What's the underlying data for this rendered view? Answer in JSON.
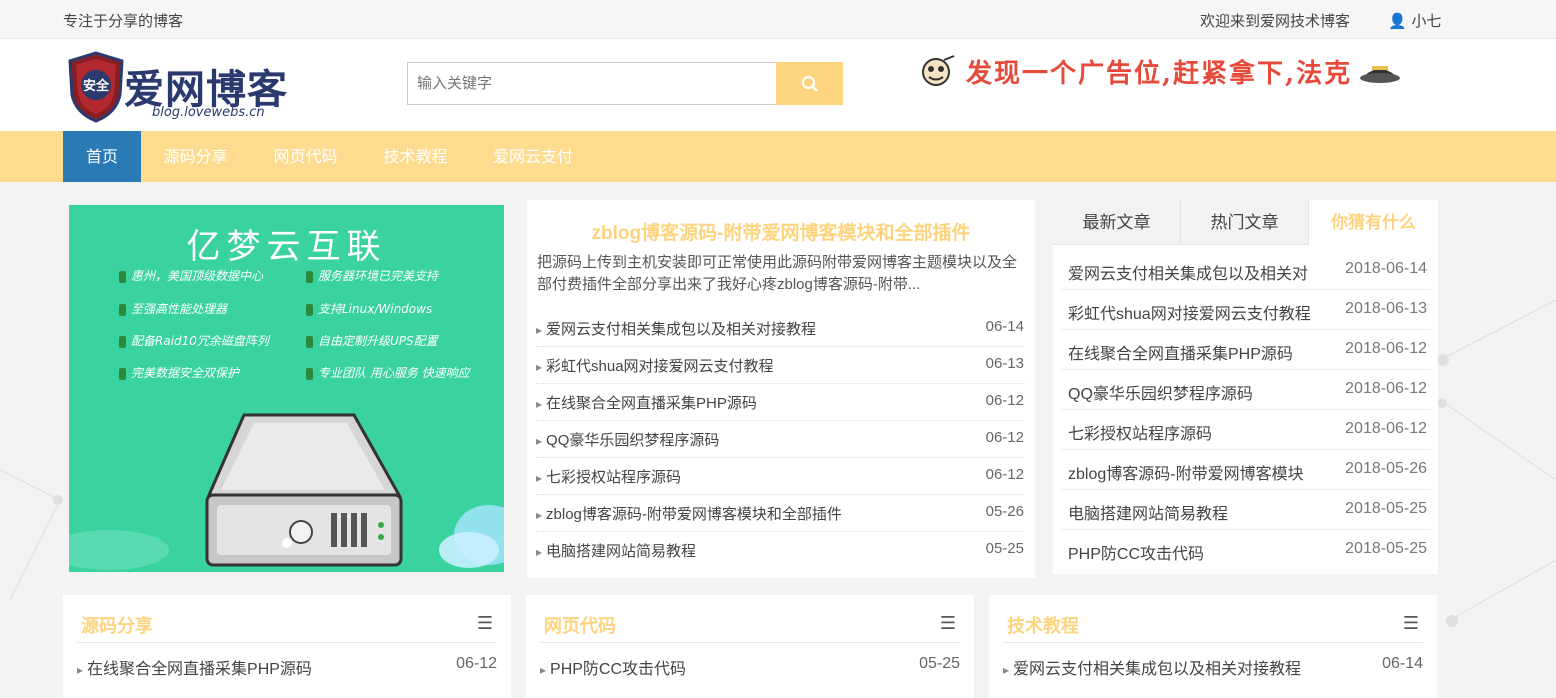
{
  "topbar": {
    "tagline": "专注于分享的博客",
    "welcome": "欢迎来到爱网技术博客",
    "user": "小七"
  },
  "logo": {
    "badge": "安全",
    "name": "爱网博客",
    "domain": "blog.lovewebs.cn"
  },
  "search": {
    "placeholder": "输入关键字"
  },
  "ad": {
    "text": "发现一个广告位,赶紧拿下,法克"
  },
  "nav": [
    "首页",
    "源码分享",
    "网页代码",
    "技术教程",
    "爱网云支付"
  ],
  "slide": {
    "title": "亿梦云互联",
    "features": [
      "惠州，美国顶级数据中心",
      "服务器环境已完美支持",
      "至强高性能处理器",
      "支持Linux/Windows",
      "配备Raid10冗余磁盘阵列",
      "自由定制升级UPS配置",
      "完美数据安全双保护",
      "专业团队 用心服务 快速响应"
    ]
  },
  "headline": {
    "title": "zblog博客源码-附带爱网博客模块和全部插件",
    "desc": "把源码上传到主机安装即可正常使用此源码附带爱网博客主题模块以及全部付费插件全部分享出来了我好心疼zblog博客源码-附带..."
  },
  "latest": [
    {
      "title": "爱网云支付相关集成包以及相关对接教程",
      "date": "06-14"
    },
    {
      "title": "彩虹代shua网对接爱网云支付教程",
      "date": "06-13"
    },
    {
      "title": "在线聚合全网直播采集PHP源码",
      "date": "06-12"
    },
    {
      "title": "QQ豪华乐园织梦程序源码",
      "date": "06-12"
    },
    {
      "title": "七彩授权站程序源码",
      "date": "06-12"
    },
    {
      "title": "zblog博客源码-附带爱网博客模块和全部插件",
      "date": "05-26"
    },
    {
      "title": "电脑搭建网站简易教程",
      "date": "05-25"
    }
  ],
  "sidebar": {
    "tabs": [
      "最新文章",
      "热门文章",
      "你猜有什么"
    ],
    "items": [
      {
        "title": "爱网云支付相关集成包以及相关对",
        "date": "2018-06-14"
      },
      {
        "title": "彩虹代shua网对接爱网云支付教程",
        "date": "2018-06-13"
      },
      {
        "title": "在线聚合全网直播采集PHP源码",
        "date": "2018-06-12"
      },
      {
        "title": "QQ豪华乐园织梦程序源码",
        "date": "2018-06-12"
      },
      {
        "title": "七彩授权站程序源码",
        "date": "2018-06-12"
      },
      {
        "title": "zblog博客源码-附带爱网博客模块",
        "date": "2018-05-26"
      },
      {
        "title": "电脑搭建网站简易教程",
        "date": "2018-05-25"
      },
      {
        "title": "PHP防CC攻击代码",
        "date": "2018-05-25"
      }
    ]
  },
  "boxes": [
    {
      "title": "源码分享",
      "first": {
        "title": "在线聚合全网直播采集PHP源码",
        "date": "06-12"
      }
    },
    {
      "title": "网页代码",
      "first": {
        "title": "PHP防CC攻击代码",
        "date": "05-25"
      }
    },
    {
      "title": "技术教程",
      "first": {
        "title": "爱网云支付相关集成包以及相关对接教程",
        "date": "06-14"
      }
    }
  ],
  "colors": {
    "accent": "#fed47f",
    "nav_bg": "#fedc8f",
    "nav_active": "#2a7ab5",
    "slide_bg": "#3ad39f"
  }
}
